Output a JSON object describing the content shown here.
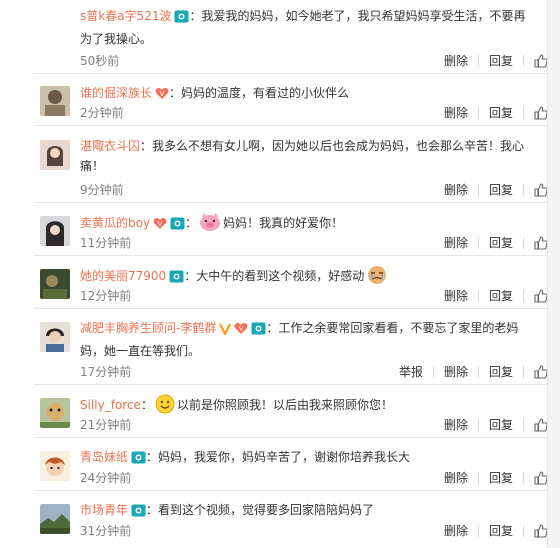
{
  "actions": {
    "delete": "删除",
    "reply": "回复",
    "report": "举报"
  },
  "comments": [
    {
      "user": "s普k春a字521波",
      "text": "：我爱我的妈妈，如今她老了，我只希望妈妈享受生活，不要再为了我操心。",
      "time": "50秒前"
    },
    {
      "user": "谁的倔深族长",
      "text": "：妈妈的温度，有看过的小伙伴么",
      "time": "2分钟前"
    },
    {
      "user": "湛陬衣斗囚",
      "text": "：我多么不想有女儿啊，因为她以后也会成为妈妈，也会那么辛苦！我心痛！",
      "time": "9分钟前"
    },
    {
      "user": "卖黄瓜的boy",
      "text": "妈妈！我真的好爱你！",
      "time": "11分钟前"
    },
    {
      "user": "她的美丽77900",
      "text": "：大中午的看到这个视频，好感动",
      "time": "12分钟前"
    },
    {
      "user": "减肥丰胸养生顾问-李鹤群",
      "text": "：工作之余要常回家看看，不要忘了家里的老妈妈，她一直在等我们。",
      "time": "17分钟前"
    },
    {
      "user": "Silly_force",
      "text": "以前是你照顾我！以后由我来照顾你您！",
      "time": "21分钟前"
    },
    {
      "user": "青岛妹纸",
      "text": "：妈妈，我爱你，妈妈辛苦了，谢谢你培养我长大",
      "time": "24分钟前"
    },
    {
      "user": "市场青年",
      "text": "：看到这个视频，觉得要多回家陪陪妈妈了",
      "time": "31分钟前"
    }
  ]
}
